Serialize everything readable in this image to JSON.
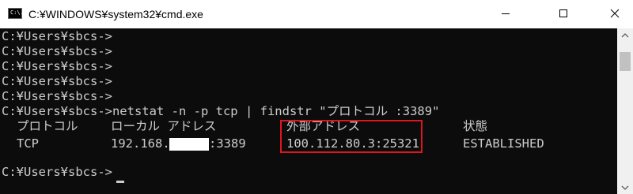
{
  "window": {
    "title": "C:¥WINDOWS¥system32¥cmd.exe",
    "icon_text": "C:\\."
  },
  "icons": {
    "app": "cmd-icon",
    "minimize": "minimize-icon",
    "maximize": "maximize-icon",
    "close": "close-icon",
    "scroll_up": "arrow-up-icon",
    "scroll_down": "arrow-down-icon"
  },
  "console": {
    "prompts": [
      "C:¥Users¥sbcs->",
      "C:¥Users¥sbcs->",
      "C:¥Users¥sbcs->",
      "C:¥Users¥sbcs->",
      "C:¥Users¥sbcs->"
    ],
    "command_line": "C:¥Users¥sbcs->netstat -n -p tcp | findstr \"プロトコル :3389\"",
    "headers": {
      "protocol": "プロトコル",
      "local": "ローカル アドレス",
      "foreign": "外部アドレス",
      "state": "状態"
    },
    "row": {
      "protocol": "TCP",
      "local_prefix": "192.168.",
      "local_suffix": ":3389",
      "foreign": "100.112.80.3:25321",
      "state": "ESTABLISHED"
    },
    "final_prompt": "C:¥Users¥sbcs->"
  },
  "colors": {
    "console_bg": "#0c0c0c",
    "console_text": "#cccccc",
    "highlight_border": "#e0141e"
  }
}
